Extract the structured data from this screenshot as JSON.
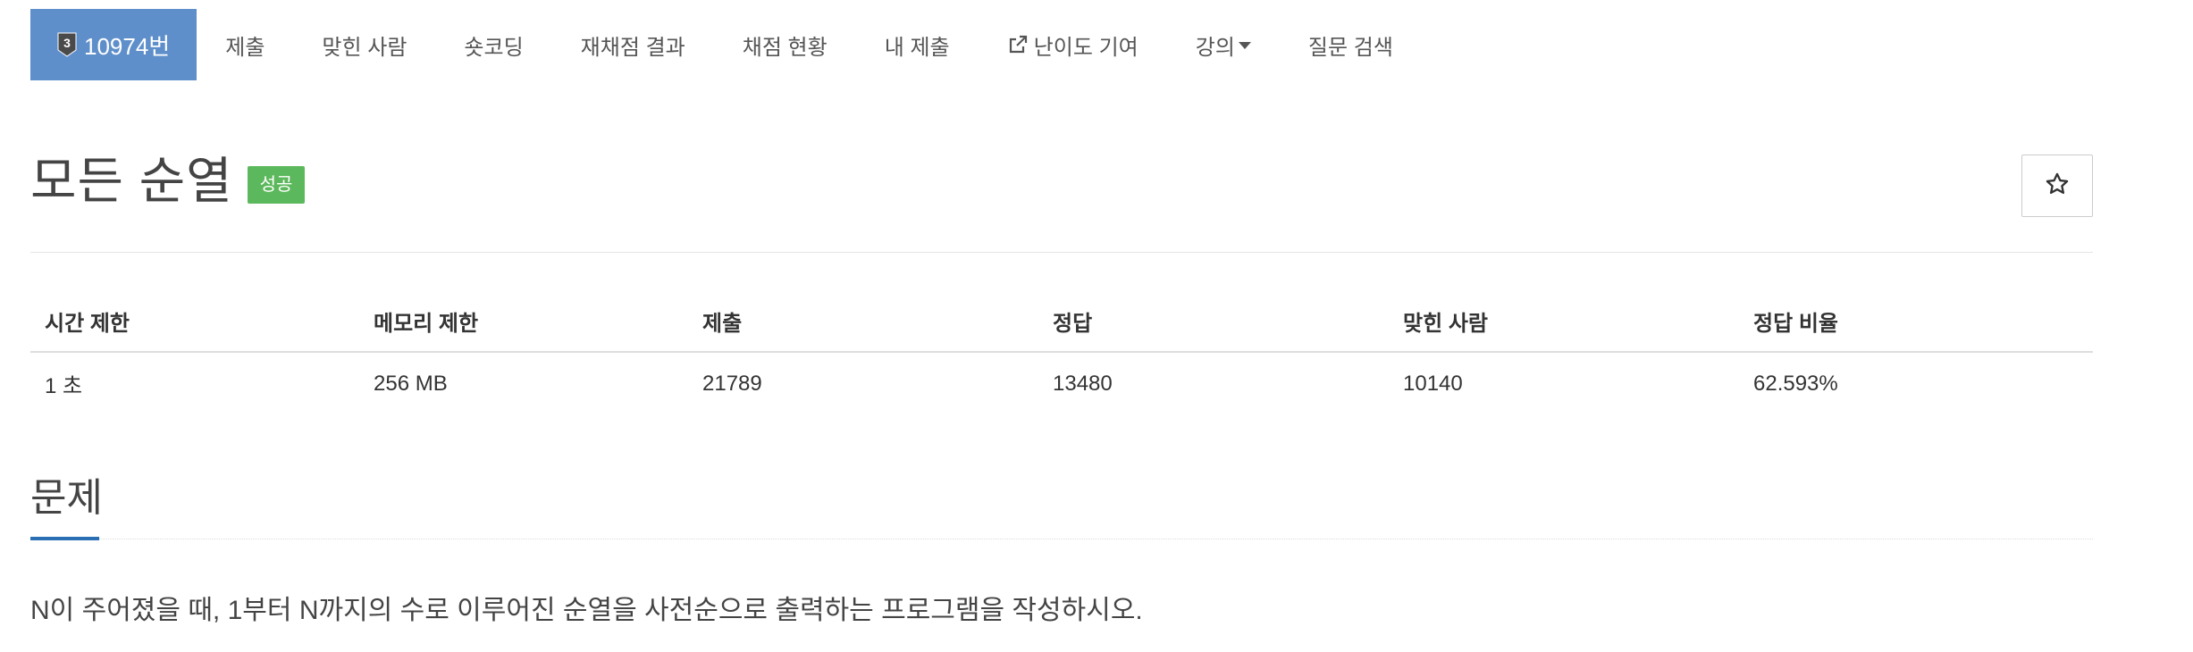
{
  "nav": {
    "problem_number": "10974번",
    "tier_number": "3",
    "items": [
      {
        "label": "제출"
      },
      {
        "label": "맞힌 사람"
      },
      {
        "label": "숏코딩"
      },
      {
        "label": "재채점 결과"
      },
      {
        "label": "채점 현황"
      },
      {
        "label": "내 제출"
      },
      {
        "label": "난이도 기여",
        "icon": "external-link-icon"
      },
      {
        "label": "강의",
        "icon": "caret-down-icon"
      },
      {
        "label": "질문 검색"
      }
    ]
  },
  "title": {
    "text": "모든 순열",
    "badge": "성공",
    "star_icon": "star-outline-icon"
  },
  "info_table": {
    "headers": [
      "시간 제한",
      "메모리 제한",
      "제출",
      "정답",
      "맞힌 사람",
      "정답 비율"
    ],
    "row": [
      "1 초",
      "256 MB",
      "21789",
      "13480",
      "10140",
      "62.593%"
    ]
  },
  "problem": {
    "section_title": "문제",
    "description": "N이 주어졌을 때, 1부터 N까지의 수로 이루어진 순열을 사전순으로 출력하는 프로그램을 작성하시오."
  },
  "colors": {
    "nav_active_bg": "#5f8fca",
    "badge_success": "#5cb85c",
    "section_accent": "#2a6fb4"
  }
}
